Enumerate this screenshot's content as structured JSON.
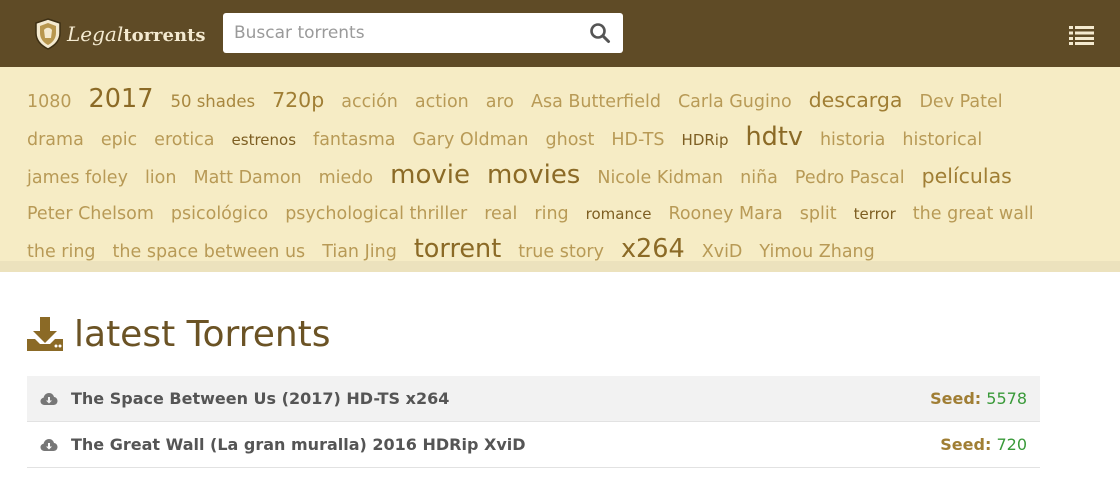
{
  "header": {
    "logo_text_a": "Legal",
    "logo_text_b": "torrents",
    "search_placeholder": "Buscar torrents",
    "search_icon": "search-icon",
    "menu_icon": "list-menu-icon",
    "background": "#5f4b26"
  },
  "tag_cloud": {
    "background": "#f6ecc5",
    "tags": [
      {
        "label": "1080",
        "size": "s1"
      },
      {
        "label": "2017",
        "size": "s4"
      },
      {
        "label": "50 shades",
        "size": "s2"
      },
      {
        "label": "720p",
        "size": "s3"
      },
      {
        "label": "acción",
        "size": "s1"
      },
      {
        "label": "action",
        "size": "s1"
      },
      {
        "label": "aro",
        "size": "s1"
      },
      {
        "label": "Asa Butterfield",
        "size": "s1"
      },
      {
        "label": "Carla Gugino",
        "size": "s1"
      },
      {
        "label": "descarga",
        "size": "s3"
      },
      {
        "label": "Dev Patel",
        "size": "s1"
      },
      {
        "label": "drama",
        "size": "s1"
      },
      {
        "label": "epic",
        "size": "s1"
      },
      {
        "label": "erotica",
        "size": "s1"
      },
      {
        "label": "estrenos",
        "size": "sm"
      },
      {
        "label": "fantasma",
        "size": "s1"
      },
      {
        "label": "Gary Oldman",
        "size": "s1"
      },
      {
        "label": "ghost",
        "size": "s1"
      },
      {
        "label": "HD-TS",
        "size": "s1"
      },
      {
        "label": "HDRip",
        "size": "sm"
      },
      {
        "label": "hdtv",
        "size": "s4"
      },
      {
        "label": "historia",
        "size": "s1"
      },
      {
        "label": "historical",
        "size": "s1"
      },
      {
        "label": "james foley",
        "size": "s1"
      },
      {
        "label": "lion",
        "size": "s1"
      },
      {
        "label": "Matt Damon",
        "size": "s1"
      },
      {
        "label": "miedo",
        "size": "s1"
      },
      {
        "label": "movie",
        "size": "s5"
      },
      {
        "label": "movies",
        "size": "s5"
      },
      {
        "label": "Nicole Kidman",
        "size": "s1"
      },
      {
        "label": "niña",
        "size": "s1"
      },
      {
        "label": "Pedro Pascal",
        "size": "s1"
      },
      {
        "label": "películas",
        "size": "s3"
      },
      {
        "label": "Peter Chelsom",
        "size": "s1"
      },
      {
        "label": "psicológico",
        "size": "s1"
      },
      {
        "label": "psychological thriller",
        "size": "s1"
      },
      {
        "label": "real",
        "size": "s1"
      },
      {
        "label": "ring",
        "size": "s1"
      },
      {
        "label": "romance",
        "size": "sm"
      },
      {
        "label": "Rooney Mara",
        "size": "s1"
      },
      {
        "label": "split",
        "size": "s1"
      },
      {
        "label": "terror",
        "size": "sm"
      },
      {
        "label": "the great wall",
        "size": "s1"
      },
      {
        "label": "the ring",
        "size": "s1"
      },
      {
        "label": "the space between us",
        "size": "s1"
      },
      {
        "label": "Tian Jing",
        "size": "s1"
      },
      {
        "label": "torrent",
        "size": "s4"
      },
      {
        "label": "true story",
        "size": "s1"
      },
      {
        "label": "x264",
        "size": "s4"
      },
      {
        "label": "XviD",
        "size": "s1"
      },
      {
        "label": "Yimou Zhang",
        "size": "s1"
      }
    ]
  },
  "latest": {
    "title": "latest Torrents",
    "title_icon": "download-icon",
    "rows": [
      {
        "title": "The Space Between Us (2017) HD-TS x264",
        "seed_label": "Seed:",
        "seed_value": "5578",
        "icon": "cloud-download-icon"
      },
      {
        "title": "The Great Wall (La gran muralla) 2016 HDRip XviD",
        "seed_label": "Seed:",
        "seed_value": "720",
        "icon": "cloud-download-icon"
      }
    ]
  }
}
